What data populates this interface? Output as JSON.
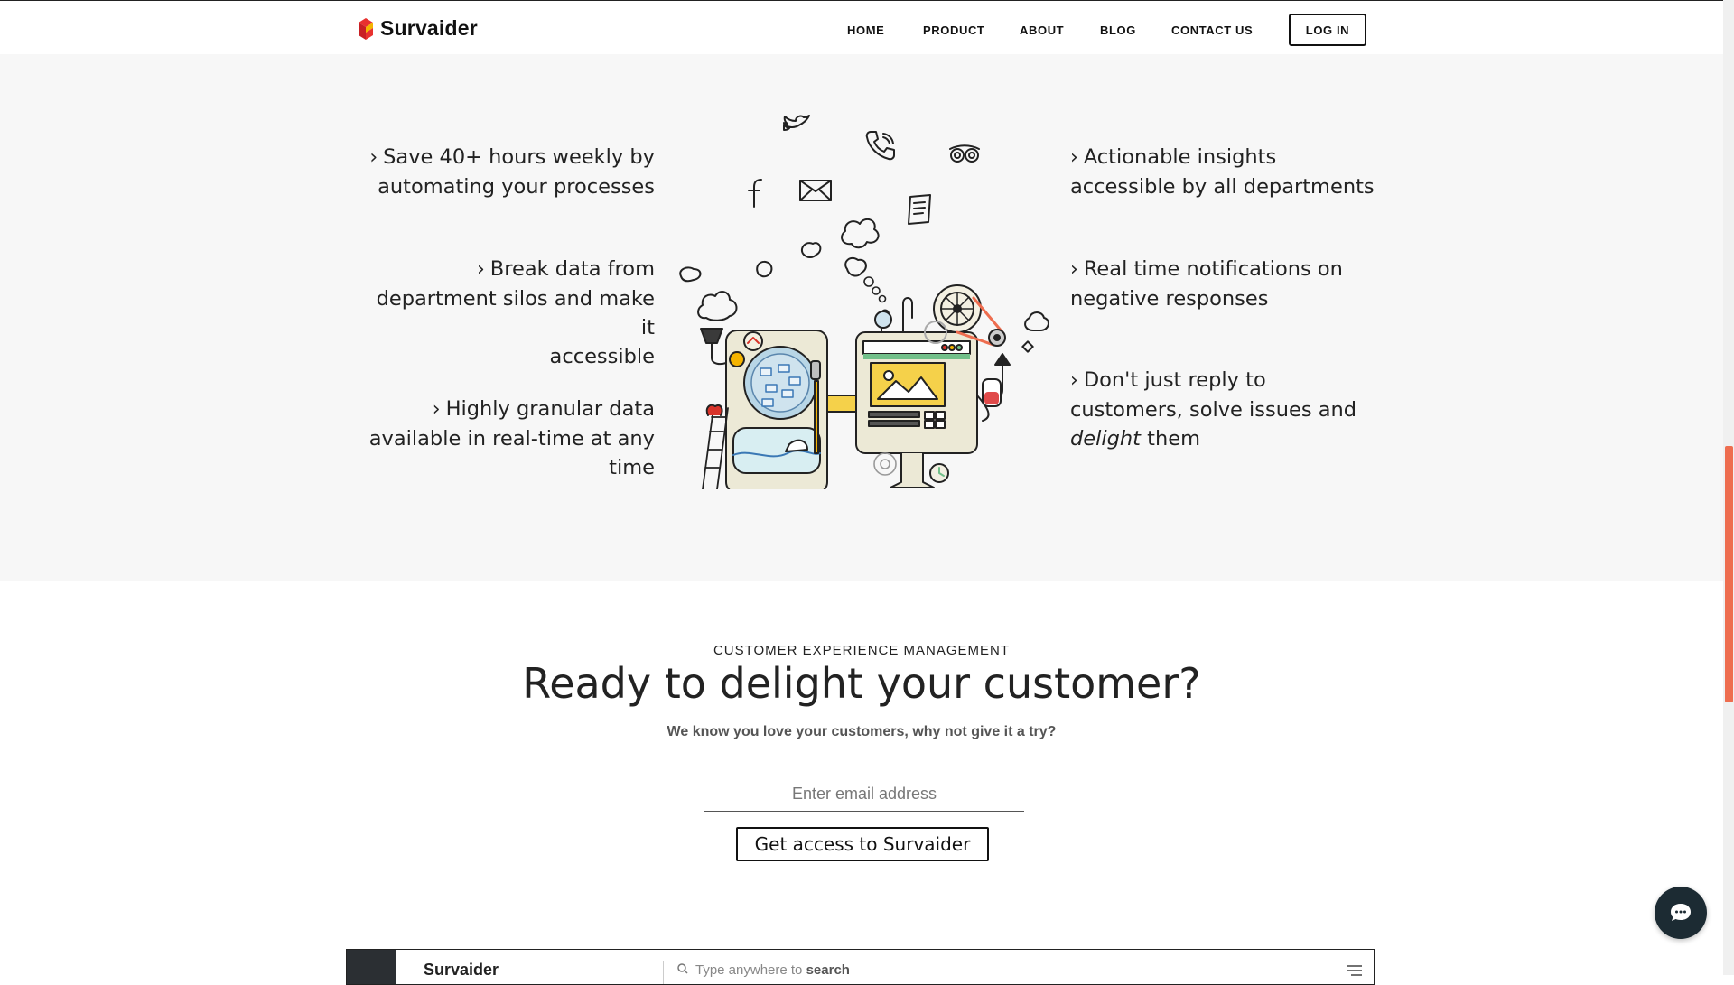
{
  "nav": {
    "brand": "Survaider",
    "links": [
      "HOME",
      "PRODUCT",
      "ABOUT",
      "BLOG",
      "CONTACT US"
    ],
    "login": "LOG IN"
  },
  "features": {
    "left": [
      {
        "icon": "chevron-right-icon",
        "lines": [
          "Save 40+ hours weekly by",
          "automating your processes"
        ]
      },
      {
        "icon": "chevron-right-icon",
        "lines": [
          "Break data from",
          "department silos and make it",
          "accessible"
        ]
      },
      {
        "icon": "chevron-right-icon",
        "lines": [
          "Highly granular data",
          "available in real-time at any",
          "time"
        ]
      }
    ],
    "right": [
      {
        "icon": "chevron-right-icon",
        "lines": [
          "Actionable insights",
          "accessible by all departments"
        ]
      },
      {
        "icon": "chevron-right-icon",
        "lines": [
          "Real time notifications on",
          "negative responses"
        ]
      },
      {
        "icon": "chevron-right-icon",
        "lines": [
          "Don't just reply to",
          "customers, solve issues and"
        ],
        "emphasis": "delight",
        "tail": " them"
      }
    ]
  },
  "illustration": {
    "name": "feedback-machine-illustration",
    "icons": [
      "twitter-icon",
      "phone-icon",
      "tripadvisor-icon",
      "facebook-icon",
      "mail-icon",
      "document-icon"
    ]
  },
  "cta": {
    "eyebrow": "CUSTOMER EXPERIENCE MANAGEMENT",
    "title": "Ready to delight your customer?",
    "subtitle": "We know you love your customers, why not give it a try?",
    "email_placeholder": "Enter email address",
    "email_value": "",
    "button": "Get access to Survaider"
  },
  "preview": {
    "brand": "Survaider",
    "search_prefix": "Type anywhere to ",
    "search_bold": "search"
  },
  "colors": {
    "accent": "#ee6d4f",
    "brand_red": "#e8312f",
    "brand_yellow": "#f5b400",
    "chat_bg": "#1c2b33",
    "section_bg": "#f7f7f7"
  }
}
